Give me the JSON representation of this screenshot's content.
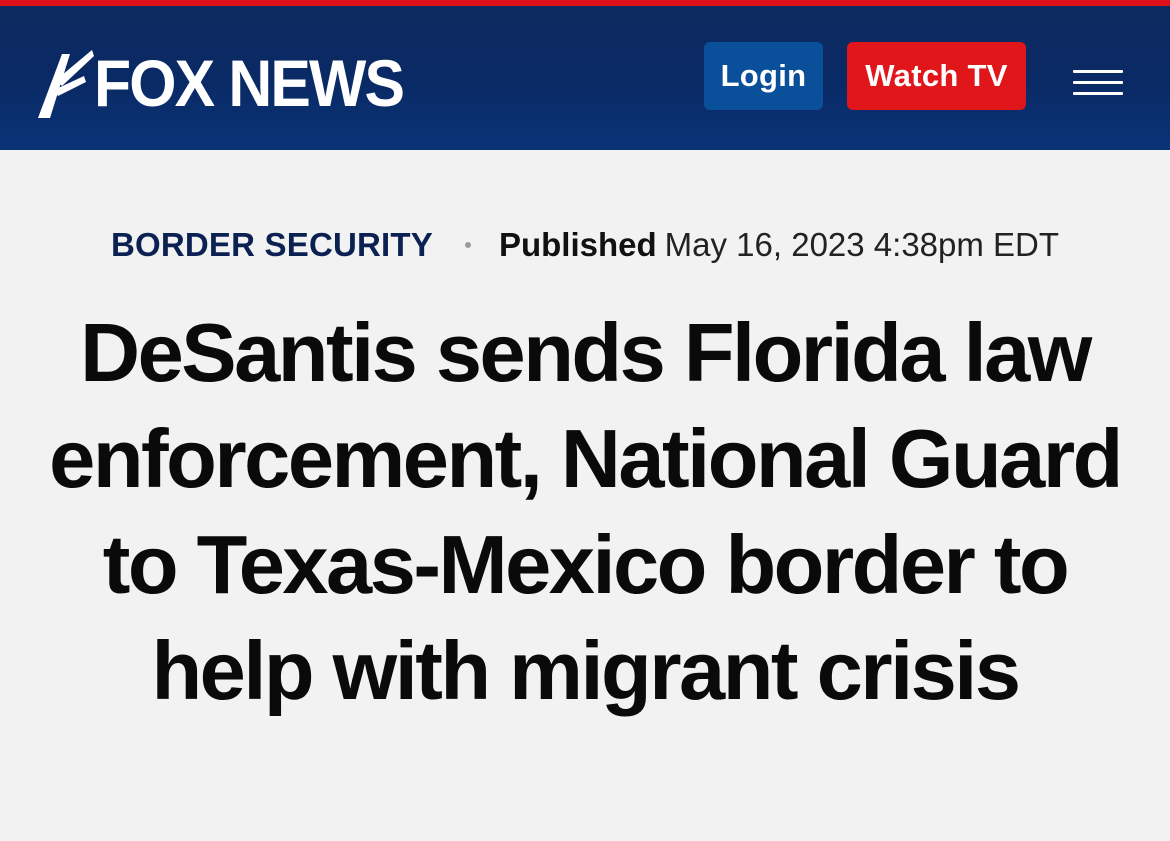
{
  "header": {
    "logo_text": "FOX NEWS",
    "login_label": "Login",
    "watch_tv_label": "Watch TV",
    "menu_icon": "hamburger-menu-icon",
    "colors": {
      "top_stripe": "#e0101b",
      "header_bg": "#0a2a66",
      "login_bg": "#0a4f99",
      "watch_tv_bg": "#e0161a"
    }
  },
  "article": {
    "category": "BORDER SECURITY",
    "published_label": "Published",
    "published_date": "May 16, 2023 4:38pm EDT",
    "headline": "DeSantis sends Florida law enforcement, National Guard to Texas-Mexico border to help with migrant crisis"
  }
}
